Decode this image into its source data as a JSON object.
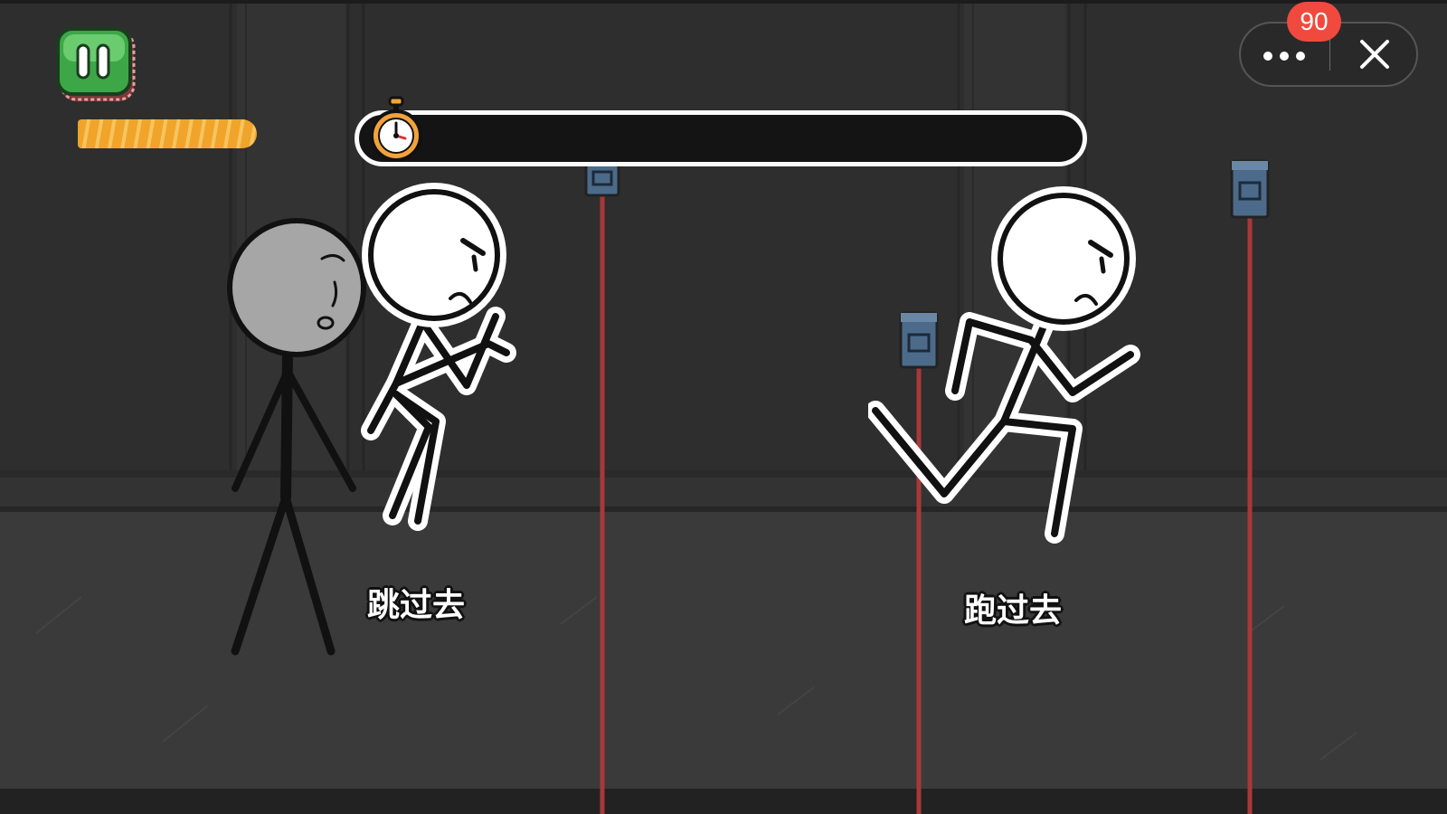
{
  "hud": {
    "pause_icon": "pause-icon",
    "notification_count": "90",
    "more_icon": "more-dots-icon",
    "close_icon": "close-icon"
  },
  "timer": {
    "icon": "stopwatch-icon",
    "remaining_fraction": 0.28,
    "fill_color": "#f0a42a"
  },
  "options": [
    {
      "label": "跳过去",
      "pose": "jumping"
    },
    {
      "label": "跑过去",
      "pose": "running"
    }
  ],
  "colors": {
    "background": "#2f2f2f",
    "floor": "#3a3a3a",
    "laser": "#a8383a",
    "emitter": "#4c6b8a",
    "pause_green": "#4caf50",
    "badge_red": "#f04a3e"
  }
}
